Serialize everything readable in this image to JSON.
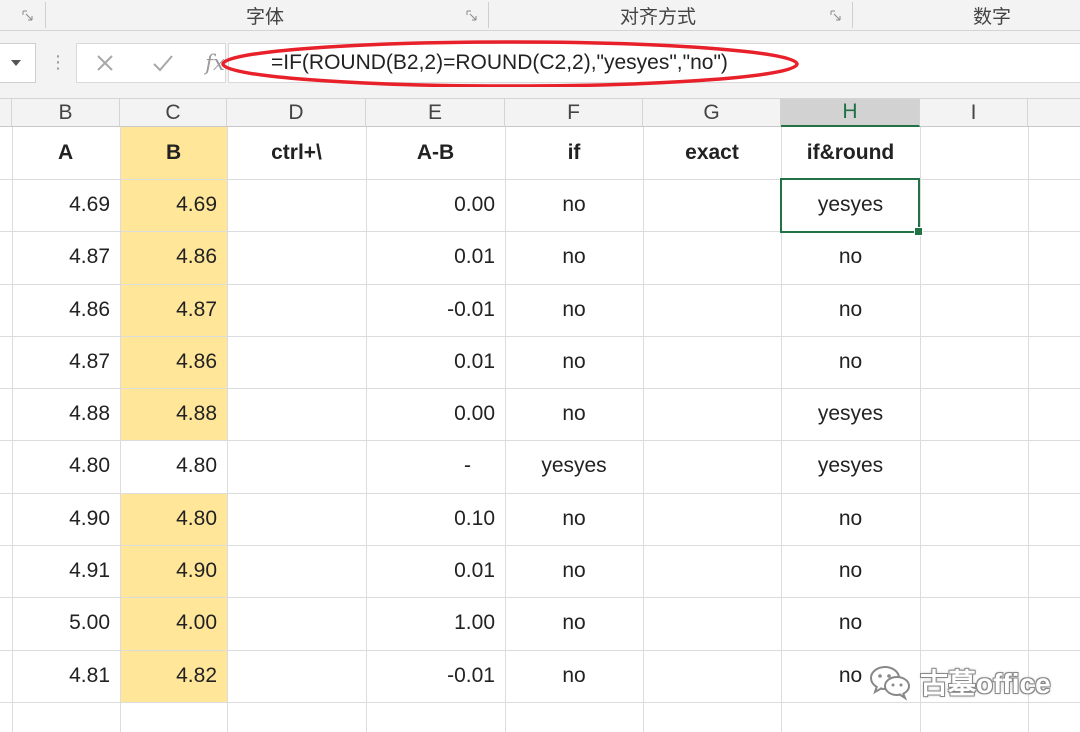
{
  "ribbon": {
    "groups": [
      "字体",
      "对齐方式",
      "数字"
    ]
  },
  "formula_bar": {
    "cancel_icon": "x-icon",
    "enter_icon": "check-icon",
    "fx_label": "fx",
    "formula": "=IF(ROUND(B2,2)=ROUND(C2,2),\"yesyes\",\"no\")",
    "highlight_color": "#e8202a"
  },
  "columns": [
    {
      "letter": "B"
    },
    {
      "letter": "C"
    },
    {
      "letter": "D"
    },
    {
      "letter": "E"
    },
    {
      "letter": "F"
    },
    {
      "letter": "G"
    },
    {
      "letter": "H"
    },
    {
      "letter": "I"
    }
  ],
  "headers": [
    "A",
    "B",
    "ctrl+\\",
    "A-B",
    "if",
    "exact",
    "if&round"
  ],
  "rows": [
    {
      "a": "4.69",
      "b": "4.69",
      "diff": "0.00",
      "if": "no",
      "ifround": "yesyes"
    },
    {
      "a": "4.87",
      "b": "4.86",
      "diff": "0.01",
      "if": "no",
      "ifround": "no"
    },
    {
      "a": "4.86",
      "b": "4.87",
      "diff": "-0.01",
      "if": "no",
      "ifround": "no"
    },
    {
      "a": "4.87",
      "b": "4.86",
      "diff": "0.01",
      "if": "no",
      "ifround": "no"
    },
    {
      "a": "4.88",
      "b": "4.88",
      "diff": "0.00",
      "if": "no",
      "ifround": "yesyes"
    },
    {
      "a": "4.80",
      "b": "4.80",
      "diff": "-",
      "if": "yesyes",
      "ifround": "yesyes"
    },
    {
      "a": "4.90",
      "b": "4.80",
      "diff": "0.10",
      "if": "no",
      "ifround": "no"
    },
    {
      "a": "4.91",
      "b": "4.90",
      "diff": "0.01",
      "if": "no",
      "ifround": "no"
    },
    {
      "a": "5.00",
      "b": "4.00",
      "diff": "1.00",
      "if": "no",
      "ifround": "no"
    },
    {
      "a": "4.81",
      "b": "4.82",
      "diff": "-0.01",
      "if": "no",
      "ifround": "no"
    }
  ],
  "colors": {
    "highlight_fill": "#ffe699",
    "selection_accent": "#217346",
    "header_bg": "#f3f3f3"
  },
  "watermark": {
    "text": "古墓office",
    "icon": "wechat-icon"
  }
}
